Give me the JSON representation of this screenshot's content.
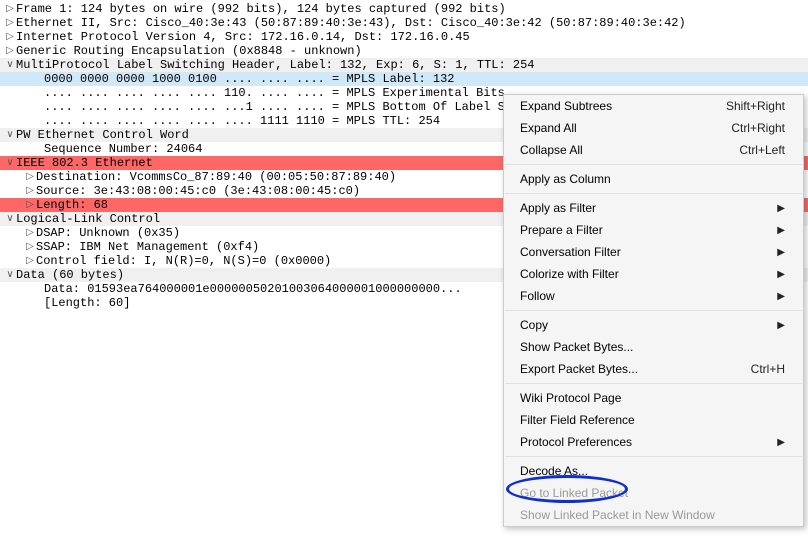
{
  "tree": {
    "frame": "Frame 1: 124 bytes on wire (992 bits), 124 bytes captured (992 bits)",
    "eth": "Ethernet II, Src: Cisco_40:3e:43 (50:87:89:40:3e:43), Dst: Cisco_40:3e:42 (50:87:89:40:3e:42)",
    "ip": "Internet Protocol Version 4, Src: 172.16.0.14, Dst: 172.16.0.45",
    "gre": "Generic Routing Encapsulation (0x8848 - unknown)",
    "mpls": "MultiProtocol Label Switching Header, Label: 132, Exp: 6, S: 1, TTL: 254",
    "mpls_label": "0000 0000 0000 1000 0100 .... .... .... = MPLS Label: 132",
    "mpls_exp": ".... .... .... .... .... 110. .... .... = MPLS Experimental Bits",
    "mpls_bos": ".... .... .... .... .... ...1 .... .... = MPLS Bottom Of Label S",
    "mpls_ttl": ".... .... .... .... .... .... 1111 1110 = MPLS TTL: 254",
    "pwcw": "PW Ethernet Control Word",
    "pwcw_seq": "Sequence Number: 24064",
    "ieee": "IEEE 802.3 Ethernet",
    "ieee_dst": "Destination: VcommsCo_87:89:40 (00:05:50:87:89:40)",
    "ieee_src": "Source: 3e:43:08:00:45:c0 (3e:43:08:00:45:c0)",
    "ieee_len": "Length: 68",
    "llc": "Logical-Link Control",
    "llc_dsap": "DSAP: Unknown (0x35)",
    "llc_ssap": "SSAP: IBM Net Management (0xf4)",
    "llc_ctrl": "Control field: I, N(R)=0, N(S)=0 (0x0000)",
    "data": "Data (60 bytes)",
    "data_bytes": "Data: 01593ea764000001e00000050201003064000001000000000...",
    "data_len": "[Length: 60]"
  },
  "menu": {
    "expand_sub": "Expand Subtrees",
    "expand_sub_k": "Shift+Right",
    "expand_all": "Expand All",
    "expand_all_k": "Ctrl+Right",
    "collapse_all": "Collapse All",
    "collapse_all_k": "Ctrl+Left",
    "apply_col": "Apply as Column",
    "apply_filter": "Apply as Filter",
    "prepare_filter": "Prepare a Filter",
    "conv_filter": "Conversation Filter",
    "colorize": "Colorize with Filter",
    "follow": "Follow",
    "copy": "Copy",
    "show_pkt": "Show Packet Bytes...",
    "export_pkt": "Export Packet Bytes...",
    "export_pkt_k": "Ctrl+H",
    "wiki": "Wiki Protocol Page",
    "filter_ref": "Filter Field Reference",
    "proto_pref": "Protocol Preferences",
    "decode_as": "Decode As...",
    "goto_linked": "Go to Linked Packet",
    "show_linked": "Show Linked Packet in New Window"
  }
}
